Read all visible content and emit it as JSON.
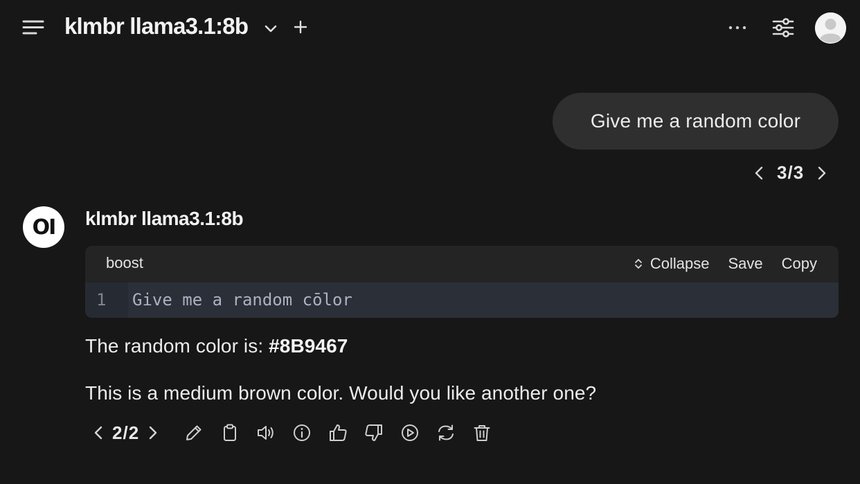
{
  "header": {
    "model_title": "klmbr llama3.1:8b",
    "icons": [
      "menu-icon",
      "chevron-down-icon",
      "plus-icon",
      "more-dots-icon",
      "controls-sliders-icon",
      "user-avatar-icon"
    ]
  },
  "user_message": {
    "text": "Give me a random color",
    "pager": {
      "current": "3",
      "sep": "/",
      "total": "3"
    }
  },
  "assistant": {
    "avatar_initials": "OI",
    "name": "klmbr llama3.1:8b",
    "code_block": {
      "language": "boost",
      "actions": {
        "collapse": "Collapse",
        "save": "Save",
        "copy": "Copy"
      },
      "line_number": "1",
      "code": "Give me a random cōlor",
      "code_parts": [
        "Give me a ran",
        "d",
        "om c",
        "ō",
        "lor"
      ]
    },
    "response_prefix": "The random color is: ",
    "response_color": "#8B9467",
    "response_line2": "This is a medium brown color. Would you like another one?",
    "pager": {
      "current": "2",
      "sep": "/",
      "total": "2"
    },
    "action_icons": [
      "edit-pencil-icon",
      "copy-clipboard-icon",
      "read-aloud-speaker-icon",
      "info-icon",
      "thumbs-up-icon",
      "thumbs-down-icon",
      "continue-play-icon",
      "regenerate-icon",
      "delete-trash-icon"
    ]
  },
  "colors": {
    "background": "#171717",
    "bubble": "#2f2f2f",
    "code_header": "#242424",
    "code_body": "#2b2f38",
    "text": "#ececec"
  }
}
